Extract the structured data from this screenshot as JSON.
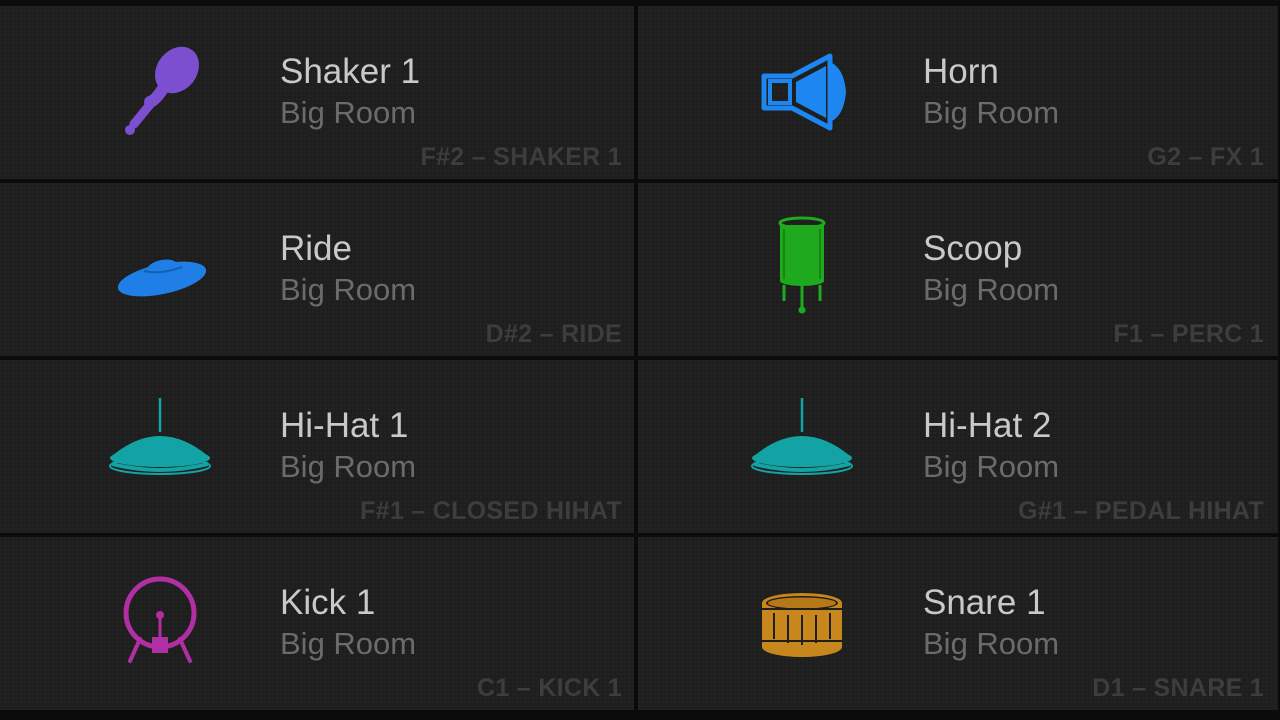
{
  "pads": [
    {
      "name": "Shaker 1",
      "kit": "Big Room",
      "note": "F#2 – SHAKER 1",
      "icon": "maraca-icon",
      "color": "#7b4fcf"
    },
    {
      "name": "Horn",
      "kit": "Big Room",
      "note": "G2 – FX 1",
      "icon": "horn-icon",
      "color": "#1d86f0"
    },
    {
      "name": "Ride",
      "kit": "Big Room",
      "note": "D#2 – RIDE",
      "icon": "ride-cymbal-icon",
      "color": "#1f7fe6"
    },
    {
      "name": "Scoop",
      "kit": "Big Room",
      "note": "F1 – PERC 1",
      "icon": "floor-drum-icon",
      "color": "#1ea91e"
    },
    {
      "name": "Hi-Hat 1",
      "kit": "Big Room",
      "note": "F#1 – CLOSED HIHAT",
      "icon": "hihat-icon",
      "color": "#14a3a5"
    },
    {
      "name": "Hi-Hat 2",
      "kit": "Big Room",
      "note": "G#1 – PEDAL HIHAT",
      "icon": "hihat-icon",
      "color": "#14a3a5"
    },
    {
      "name": "Kick 1",
      "kit": "Big Room",
      "note": "C1 – KICK 1",
      "icon": "kick-drum-icon",
      "color": "#b22fa3"
    },
    {
      "name": "Snare 1",
      "kit": "Big Room",
      "note": "D1 – SNARE 1",
      "icon": "snare-drum-icon",
      "color": "#c7871c"
    }
  ]
}
